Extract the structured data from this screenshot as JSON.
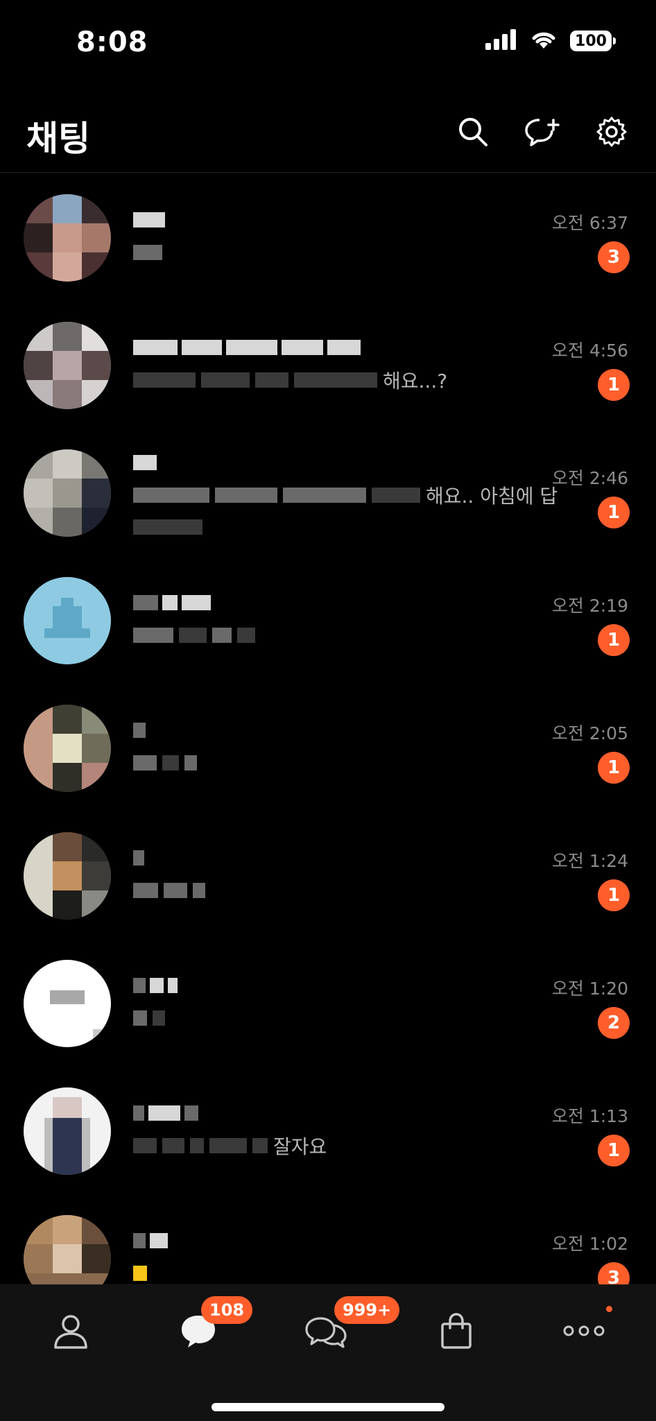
{
  "status_bar": {
    "time": "8:08",
    "battery": "100"
  },
  "header": {
    "title": "채팅",
    "icons": [
      "search-icon",
      "new-chat-icon",
      "settings-icon"
    ]
  },
  "chats": [
    {
      "time": "오전 6:37",
      "badge": "3",
      "preview_tail": ""
    },
    {
      "time": "오전 4:56",
      "badge": "1",
      "preview_tail": "해요...?"
    },
    {
      "time": "오전 2:46",
      "badge": "1",
      "preview_tail": "해요.. 아침에 답"
    },
    {
      "time": "오전 2:19",
      "badge": "1",
      "preview_tail": ""
    },
    {
      "time": "오전 2:05",
      "badge": "1",
      "preview_tail": ""
    },
    {
      "time": "오전 1:24",
      "badge": "1",
      "preview_tail": ""
    },
    {
      "time": "오전 1:20",
      "badge": "2",
      "preview_tail": ""
    },
    {
      "time": "오전 1:13",
      "badge": "1",
      "preview_tail": "잘자요"
    },
    {
      "time": "오전 1:02",
      "badge": "3",
      "preview_tail": ""
    }
  ],
  "tab_bar": {
    "friends_icon": "person-icon",
    "chats_badge": "108",
    "openchat_badge": "999+",
    "shopping_icon": "shopping-bag-icon",
    "more_icon": "more-dots-icon"
  }
}
